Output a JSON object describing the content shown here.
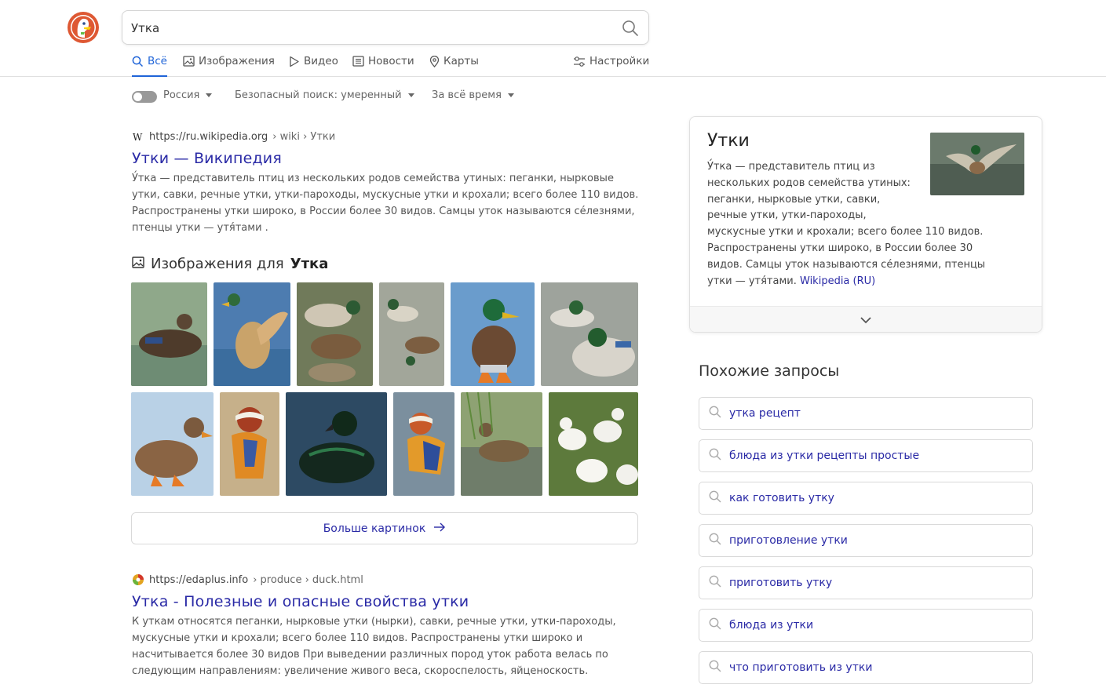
{
  "search": {
    "query": "Утка"
  },
  "tabs": [
    {
      "label": "Всё",
      "icon": "search-icon"
    },
    {
      "label": "Изображения",
      "icon": "image-icon"
    },
    {
      "label": "Видео",
      "icon": "play-icon"
    },
    {
      "label": "Новости",
      "icon": "news-icon"
    },
    {
      "label": "Карты",
      "icon": "map-pin-icon"
    }
  ],
  "settings_label": "Настройки",
  "filters": {
    "region": "Россия",
    "safe_search": "Безопасный поиск: умеренный",
    "time": "За всё время"
  },
  "results": [
    {
      "host": "https://ru.wikipedia.org",
      "path": "› wiki › Утки",
      "title": "Утки — Википедия",
      "snippet": "У́тка — представитель птиц из нескольких родов семейства утиных: пеганки, нырковые утки, савки, речные утки, утки-пароходы, мускусные утки и крохали; всего более 110 видов. Распространены утки широко, в России более 30 видов. Самцы уток называются се́лезнями, птенцы утки — утя́тами ."
    },
    {
      "host": "https://edaplus.info",
      "path": "› produce › duck.html",
      "title": "Утка - Полезные и опасные свойства утки",
      "snippet": "К уткам относятся пеганки, нырковые утки (нырки), савки, речные утки, утки-пароходы, мускусные утки и крохали; всего более 110 видов. Распространены утки широко и насчитывается более 30 видов При выведении различных пород уток работа велась по следующим направлениям: увеличение живого веса, скороспелость, яйценоскость."
    }
  ],
  "images": {
    "heading_prefix": "Изображения для",
    "heading_query": "Утка",
    "more_label": "Больше картинок"
  },
  "knowledge_panel": {
    "title": "Утки",
    "text_line1": "У́тка — представитель птиц из нескольких родов семейства утиных: пеганки, нырковые утки, савки, речные утки, утки-пароходы,",
    "text_rest": "мускусные утки и крохали; всего более 110 видов. Распространены утки широко, в России более 30 видов. Самцы уток называются се́лезнями, птенцы утки — утя́тами.",
    "source": "Wikipedia (RU)"
  },
  "related": {
    "heading": "Похожие запросы",
    "items": [
      "утка рецепт",
      "блюда из утки рецепты простые",
      "как готовить утку",
      "приготовление утки",
      "приготовить утку",
      "блюда из утки",
      "что приготовить из утки"
    ]
  },
  "colors": {
    "accent": "#1f64d8",
    "link": "#2a2aa6",
    "brand": "#de5833"
  }
}
